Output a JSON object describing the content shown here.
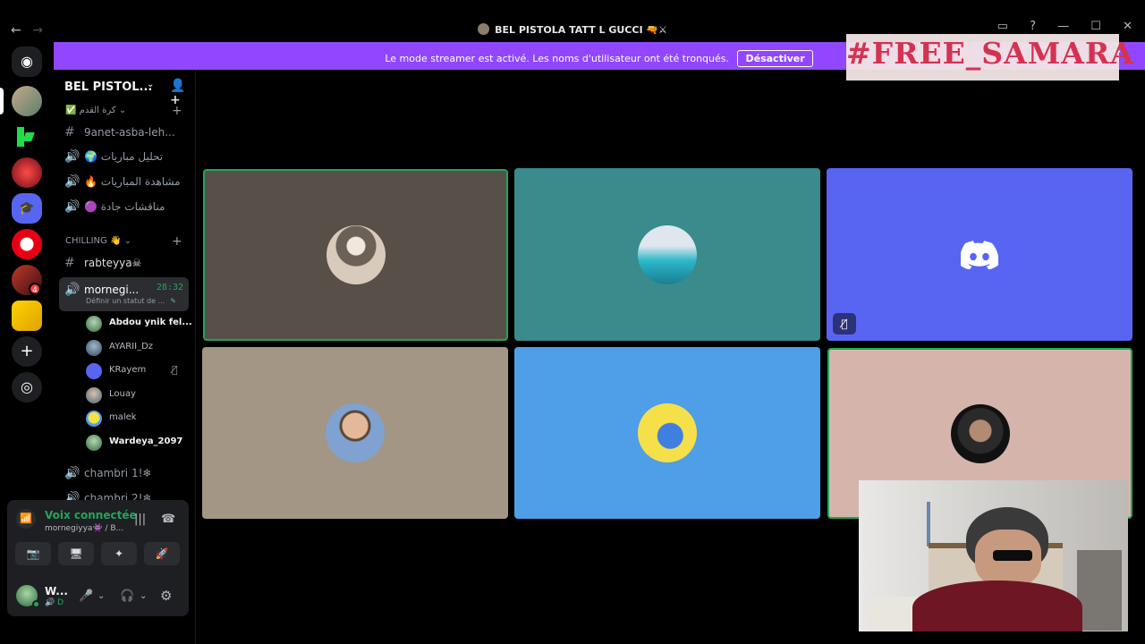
{
  "window": {
    "title": "BEL PISTOLA TATT L GUCCI 🔫⚔",
    "back_glyph": "←",
    "forward_glyph": "→",
    "controls": [
      "▭",
      "?",
      "—",
      "☐",
      "✕"
    ]
  },
  "banner": {
    "text": "Le mode streamer est activé. Les noms d'utilisateur ont été tronqués.",
    "button_label": "Désactiver",
    "close_glyph": "✕"
  },
  "overlay": {
    "text": "#FREE_SAMARA"
  },
  "rail": {
    "home_glyph": "◉",
    "badge_count": "4",
    "add_glyph": "+",
    "explore_glyph": "◎"
  },
  "server": {
    "name": "BEL PISTOL...",
    "chevron": "⌄",
    "invite_glyph": "👤+"
  },
  "categories": [
    {
      "label": "✅ كرة القدم ⌄",
      "plus": "+"
    },
    {
      "label": "CHILLING 👋 ⌄",
      "plus": "+"
    }
  ],
  "channels": [
    {
      "name": "9anet-asba-leh...",
      "icon": "#"
    },
    {
      "name": "🌍 تحليل مباريات",
      "icon": "🔊"
    },
    {
      "name": "🔥 مشاهدة المباريات",
      "icon": "🔊"
    },
    {
      "name": "🟣 مناقشات جادة",
      "icon": "🔊"
    },
    {
      "name": "rabteyya☠",
      "icon": "#"
    },
    {
      "name": "mornegi...",
      "icon": "🔊",
      "timer": "28:32",
      "status": "Définir un statut de ...",
      "edit_glyph": "✎"
    },
    {
      "name": "chambri 1!❄",
      "icon": "🔊"
    },
    {
      "name": "chambri 2!❄",
      "icon": "🔊"
    }
  ],
  "voice_users": [
    {
      "name": "Abdou ynik fel...",
      "bold": true
    },
    {
      "name": "AYARII_Dz",
      "bold": false
    },
    {
      "name": "KRayem",
      "bold": false,
      "muted_glyph": "🎙̸"
    },
    {
      "name": "Louay",
      "bold": false
    },
    {
      "name": "malek",
      "bold": false
    },
    {
      "name": "Wardeya_2097",
      "bold": true
    }
  ],
  "voice_panel": {
    "title": "Voix connectée",
    "subtitle": "mornegiyya👾 / B...",
    "signal_glyph": "📶",
    "wave_glyph": "|||",
    "hangup_glyph": "☎",
    "buttons": [
      "📷",
      "🖥",
      "✦",
      "🚀"
    ]
  },
  "user": {
    "name": "W...",
    "status": "🔊 D",
    "mic_glyph": "🎤",
    "headset_glyph": "🎧",
    "settings_glyph": "⚙",
    "chevron": "⌄"
  },
  "stage": {
    "tiles": [
      {
        "bg": "#575049",
        "speaking": true
      },
      {
        "bg": "#3a8b8b",
        "speaking": false
      },
      {
        "bg": "#5865f2",
        "speaking": false,
        "logo": true,
        "muted": true
      },
      {
        "bg": "#a39684",
        "speaking": false
      },
      {
        "bg": "#4e9ee8",
        "speaking": false
      },
      {
        "bg": "#d5b5ab",
        "speaking": true
      }
    ],
    "mute_glyph": "🎙̸"
  },
  "colors": {
    "accent": "#9147ff",
    "online": "#23a55a",
    "blurple": "#5865f2"
  }
}
